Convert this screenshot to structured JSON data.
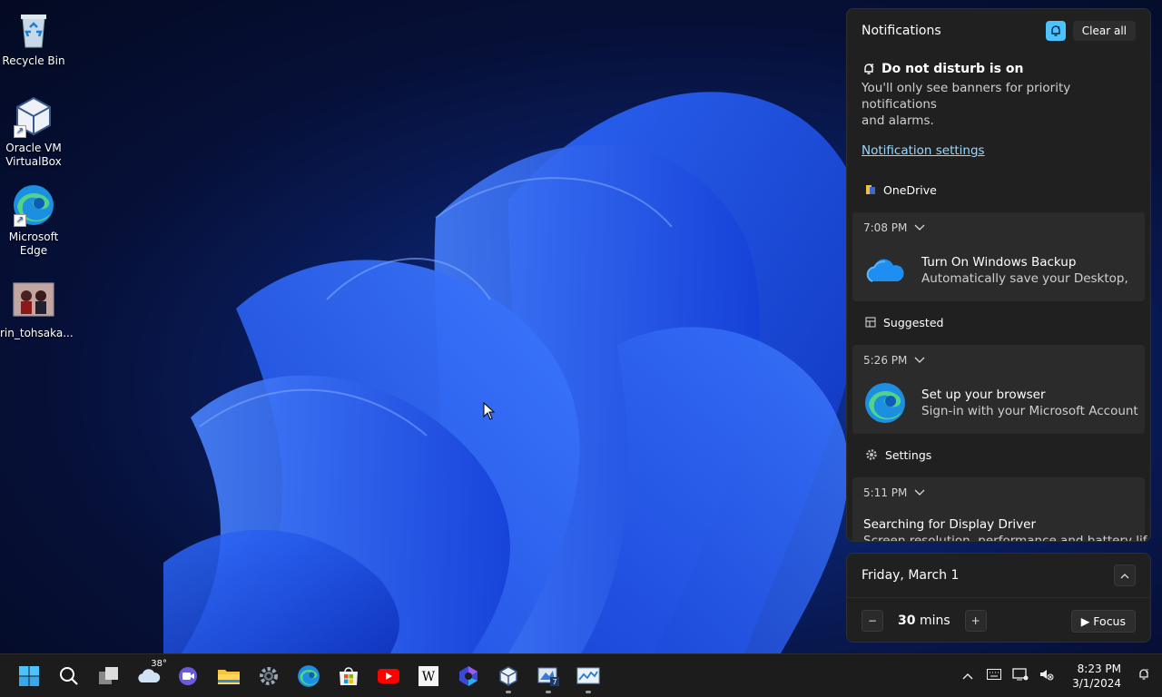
{
  "desktop": {
    "icons": [
      {
        "label": "Recycle Bin"
      },
      {
        "label_line1": "Oracle VM",
        "label_line2": "VirtualBox"
      },
      {
        "label_line1": "Microsoft",
        "label_line2": "Edge"
      },
      {
        "label": "rin_tohsaka..."
      }
    ]
  },
  "notifications": {
    "title": "Notifications",
    "clear_all": "Clear all",
    "dnd_title": "Do not disturb is on",
    "dnd_desc_line1": "You'll only see banners for priority notifications",
    "dnd_desc_line2": "and alarms.",
    "settings_link": "Notification settings",
    "groups": [
      {
        "app": "OneDrive",
        "time": "7:08 PM",
        "title": "Turn On Windows Backup",
        "subtitle": "Automatically save your Desktop,"
      },
      {
        "app": "Suggested",
        "time": "5:26 PM",
        "title": "Set up your browser",
        "subtitle": "Sign-in with your Microsoft Account"
      },
      {
        "app": "Settings",
        "time": "5:11 PM",
        "title": "Searching for Display Driver",
        "subtitle": "Screen resolution, performance and battery life"
      }
    ]
  },
  "calendar": {
    "date": "Friday, March 1",
    "focus_value": "30",
    "focus_unit": "mins",
    "focus_button": "Focus"
  },
  "taskbar": {
    "weather_temp": "38°",
    "clock_time": "8:23 PM",
    "clock_date": "3/1/2024"
  },
  "colors": {
    "accent": "#4cc2ff",
    "link": "#9ad9ff",
    "panel_bg": "#202020",
    "taskbar_bg": "#1c1c1c"
  }
}
